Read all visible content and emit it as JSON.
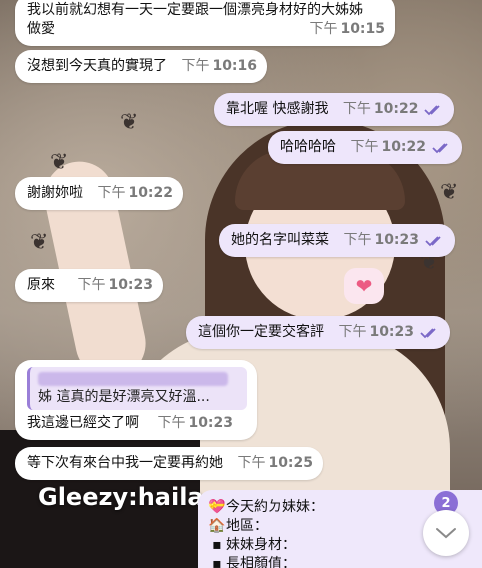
{
  "messages": [
    {
      "id": 1,
      "side": "in",
      "lines": [
        "我以前就幻想有一天一定要跟一個漂亮身材好的大姊姊",
        "做愛"
      ],
      "time_prefix": "下午",
      "time": "10:15"
    },
    {
      "id": 2,
      "side": "in",
      "lines": [
        "沒想到今天真的實現了"
      ],
      "time_prefix": "下午",
      "time": "10:16"
    },
    {
      "id": 3,
      "side": "out",
      "lines": [
        "靠北喔 快感謝我"
      ],
      "time_prefix": "下午",
      "time": "10:22",
      "read": true
    },
    {
      "id": 4,
      "side": "out",
      "lines": [
        "哈哈哈哈"
      ],
      "time_prefix": "下午",
      "time": "10:22",
      "read": true
    },
    {
      "id": 5,
      "side": "in",
      "lines": [
        "謝謝妳啦"
      ],
      "time_prefix": "下午",
      "time": "10:22"
    },
    {
      "id": 6,
      "side": "out",
      "lines": [
        "她的名字叫菜菜"
      ],
      "time_prefix": "下午",
      "time": "10:23",
      "read": true
    },
    {
      "id": 7,
      "side": "in",
      "lines": [
        "原來"
      ],
      "time_prefix": "下午",
      "time": "10:23"
    },
    {
      "id": 8,
      "side": "out",
      "lines": [
        "這個你一定要交客評"
      ],
      "time_prefix": "下午",
      "time": "10:23",
      "read": true
    },
    {
      "id": 9,
      "side": "in",
      "quote": "姊 這真的是好漂亮又好溫...",
      "lines": [
        "我這邊已經交了啊"
      ],
      "time_prefix": "下午",
      "time": "10:23"
    },
    {
      "id": 10,
      "side": "in",
      "lines": [
        "等下次有來台中我一定要再約她"
      ],
      "time_prefix": "下午",
      "time": "10:25"
    }
  ],
  "watermark": "Gleezy:haila",
  "sticker": {
    "icon": "heart-icon",
    "glyph": "❤"
  },
  "card": {
    "lines": [
      {
        "icon": "heart-gift-icon",
        "glyph": "💝",
        "text": "今天約ㄉ妹妹："
      },
      {
        "icon": "house-icon",
        "glyph": "🏠",
        "text": "地區："
      },
      {
        "icon": "black-square-icon",
        "glyph": "▪",
        "text": "妹妹身材："
      },
      {
        "icon": "black-square-icon",
        "glyph": "▪",
        "text": "長相顏值："
      }
    ]
  },
  "unread_badge": "2",
  "colors": {
    "incoming": "#ffffff",
    "outgoing": "#eee6fb",
    "accent": "#8b6fd6",
    "time": "#7a7a7a"
  }
}
